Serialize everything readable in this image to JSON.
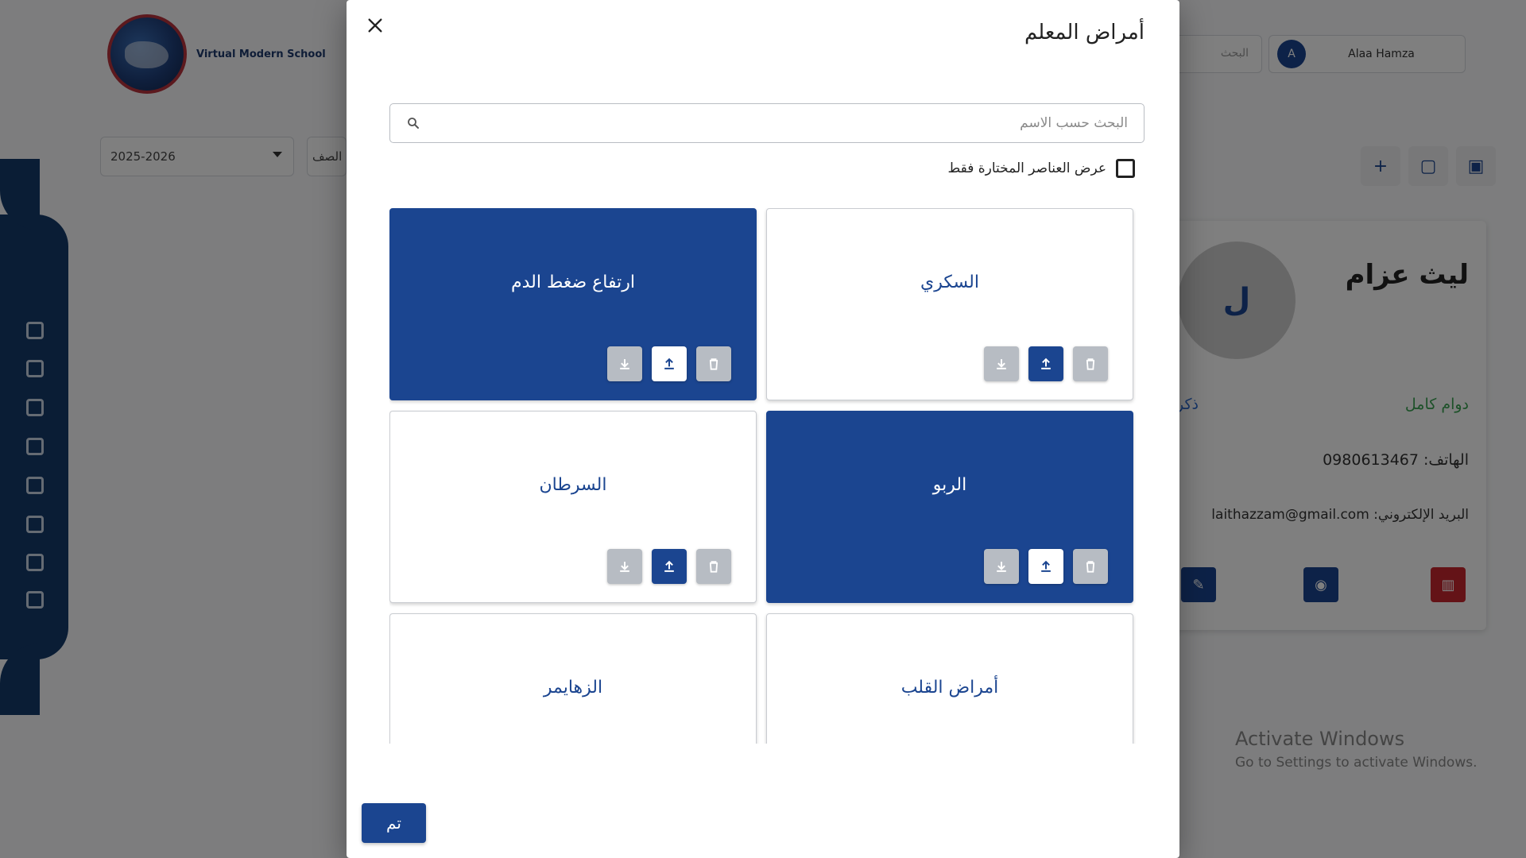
{
  "background": {
    "logo_text": "Virtual Modern School",
    "top_search_placeholder": "البحث",
    "user": {
      "initial": "A",
      "name": "Alaa Hamza"
    },
    "year_select": "2025-2026",
    "class_select": "الصف",
    "action_icons": [
      "plus-icon",
      "document-icon",
      "image-icon"
    ],
    "profile": {
      "avatar_initial": "ل",
      "name": "ليث عزام",
      "employment": "دوام كامل",
      "gender": "ذكر",
      "phone": "الهاتف: 0980613467",
      "email": "البريد الإلكتروني: laithazzam@gmail.com"
    },
    "activate_windows": {
      "title": "Activate Windows",
      "subtitle": "Go to Settings to activate Windows."
    }
  },
  "modal": {
    "title": "أمراض المعلم",
    "search": {
      "placeholder": "البحث حسب الاسم",
      "value": ""
    },
    "filter": {
      "label": "عرض العناصر المختارة فقط",
      "checked": false
    },
    "items": [
      {
        "label": "السكري",
        "selected": false
      },
      {
        "label": "ارتفاع ضغط الدم",
        "selected": true
      },
      {
        "label": "الربو",
        "selected": true
      },
      {
        "label": "السرطان",
        "selected": false
      },
      {
        "label": "أمراض القلب",
        "selected": false
      },
      {
        "label": "الزهايمر",
        "selected": false
      }
    ],
    "done_label": "تم"
  },
  "colors": {
    "primary": "#1b4590",
    "overlay": "rgba(0,0,0,0.5)",
    "muted_button": "#b7bcc3",
    "green": "#3aa352",
    "red": "#c8262f"
  }
}
